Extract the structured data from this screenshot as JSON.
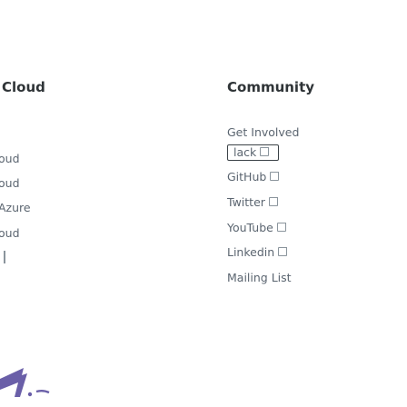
{
  "left_column": {
    "heading": "Cloud",
    "items": [
      "oud",
      "oud",
      "Azure",
      "oud",
      ""
    ]
  },
  "right_column": {
    "heading": "Community",
    "items": [
      {
        "label": "Get Involved",
        "external": false
      },
      {
        "label": "lack",
        "external": true
      },
      {
        "label": "GitHub",
        "external": true
      },
      {
        "label": "Twitter",
        "external": true
      },
      {
        "label": "YouTube",
        "external": true
      },
      {
        "label": "Linkedin",
        "external": true
      },
      {
        "label": "Mailing List",
        "external": false
      }
    ]
  },
  "icons": {
    "external_link": "external-link-icon",
    "logo": "brand-logo-icon"
  },
  "colors": {
    "heading": "#2f3437",
    "link": "#5b6570",
    "logo": "#6a5fa8",
    "background": "#ffffff"
  }
}
